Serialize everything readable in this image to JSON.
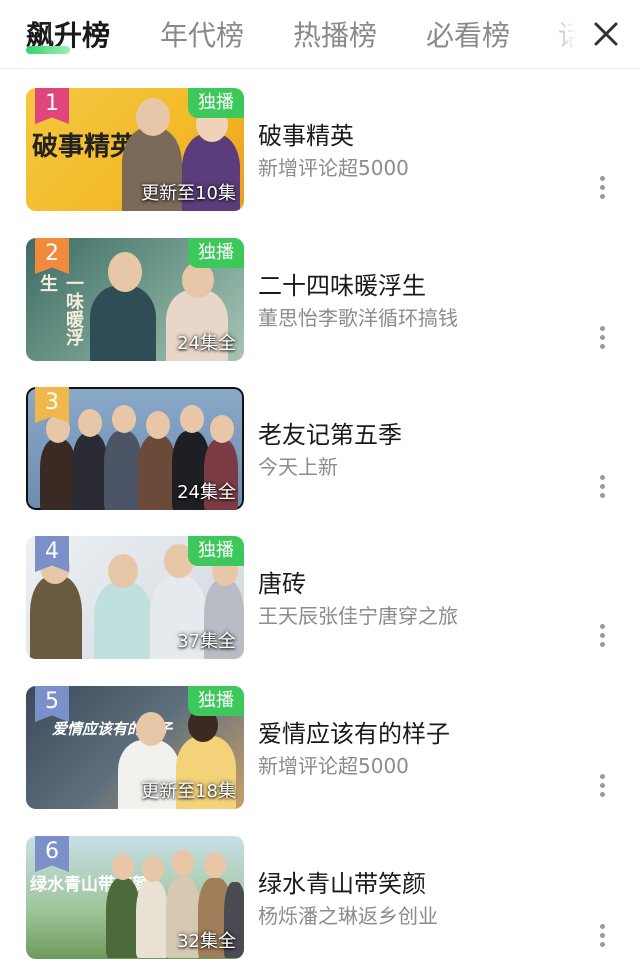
{
  "tabs": [
    {
      "label": "飙升榜",
      "active": true
    },
    {
      "label": "年代榜"
    },
    {
      "label": "热播榜"
    },
    {
      "label": "必看榜"
    },
    {
      "label": "话"
    }
  ],
  "close_icon": "close-icon",
  "colors": {
    "accent_green": "#3cc85a",
    "rank1": "#e0457b",
    "rank2": "#f08a3c",
    "rank3": "#f0b84a",
    "rank_other": "#7b8fc8"
  },
  "items": [
    {
      "rank": "1",
      "title": "破事精英",
      "subtitle": "新增评论超5000",
      "badge": "独播",
      "episodes": "更新至10集",
      "poster_text": "破事精英"
    },
    {
      "rank": "2",
      "title": "二十四味暖浮生",
      "subtitle": "董思怡李歌洋循环搞钱",
      "badge": "独播",
      "episodes": "24集全",
      "poster_text": "一味暖浮生"
    },
    {
      "rank": "3",
      "title": "老友记第五季",
      "subtitle": "今天上新",
      "badge": "",
      "episodes": "24集全",
      "poster_text": ""
    },
    {
      "rank": "4",
      "title": "唐砖",
      "subtitle": "王天辰张佳宁唐穿之旅",
      "badge": "独播",
      "episodes": "37集全",
      "poster_text": ""
    },
    {
      "rank": "5",
      "title": "爱情应该有的样子",
      "subtitle": "新增评论超5000",
      "badge": "独播",
      "episodes": "更新至18集",
      "poster_text": "爱情应该有的样子"
    },
    {
      "rank": "6",
      "title": "绿水青山带笑颜",
      "subtitle": "杨烁潘之琳返乡创业",
      "badge": "",
      "episodes": "32集全",
      "poster_text": "绿水青山带笑颜"
    }
  ]
}
